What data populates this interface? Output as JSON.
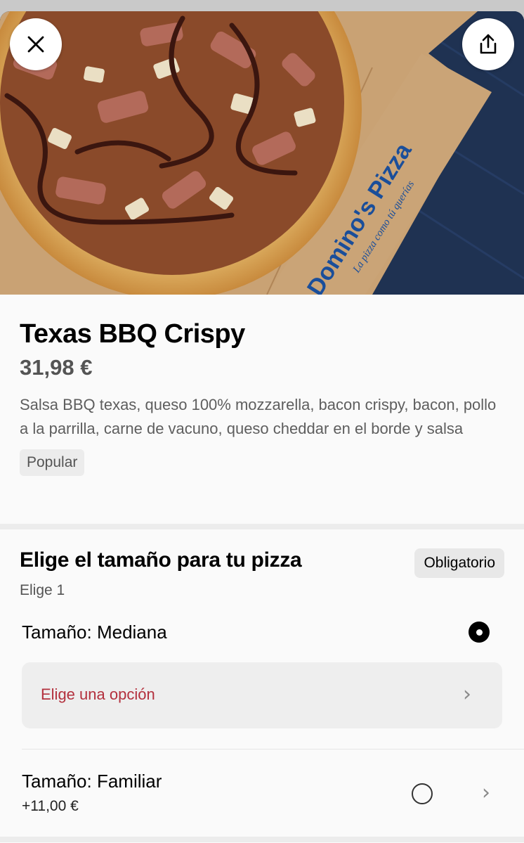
{
  "header": {
    "close_icon": "close-icon",
    "share_icon": "share-icon",
    "box_brand_text": "Domino's Pizza",
    "box_tagline": "La pizza como tú querías"
  },
  "product": {
    "title": "Texas BBQ Crispy",
    "price": "31,98 €",
    "description": "Salsa BBQ texas, queso 100% mozzarella, bacon crispy, bacon, pollo a la parrilla, carne de vacuno, queso cheddar en el borde y salsa",
    "badge": "Popular"
  },
  "size_section": {
    "title": "Elige el tamaño para tu pizza",
    "required_label": "Obligatorio",
    "subtitle": "Elige 1",
    "options": [
      {
        "label": "Tamaño: Mediana",
        "selected": true,
        "sub_prompt": "Elige una opción"
      },
      {
        "label": "Tamaño: Familiar",
        "extra_price": "+11,00 €",
        "selected": false
      }
    ]
  },
  "colors": {
    "accent_red": "#b3303d",
    "background": "#fafafa"
  }
}
